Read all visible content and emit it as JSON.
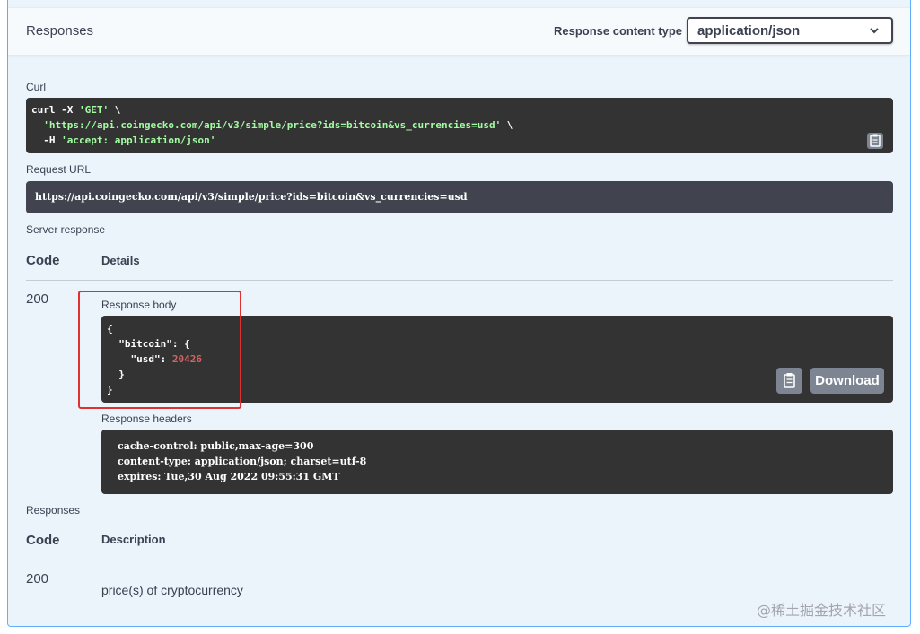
{
  "header": {
    "title": "Responses",
    "content_type_label": "Response content type",
    "content_type_value": "application/json"
  },
  "curl": {
    "label": "Curl",
    "lines": [
      {
        "prefix": "curl -X ",
        "str": "'GET'",
        "suffix": " \\"
      },
      {
        "prefix": "  ",
        "str": "'https://api.coingecko.com/api/v3/simple/price?ids=bitcoin&vs_currencies=usd'",
        "suffix": " \\"
      },
      {
        "prefix": "  -H ",
        "str": "'accept: application/json'",
        "suffix": ""
      }
    ]
  },
  "request_url": {
    "label": "Request URL",
    "value": "https://api.coingecko.com/api/v3/simple/price?ids=bitcoin&vs_currencies=usd"
  },
  "server_response": {
    "label": "Server response",
    "col_code": "Code",
    "col_details": "Details",
    "code": "200",
    "body_label": "Response body",
    "body_lines": [
      {
        "text": "{"
      },
      {
        "text": "  \"bitcoin\": {"
      },
      {
        "key": "    \"usd\": ",
        "num": "20426"
      },
      {
        "text": "  }"
      },
      {
        "text": "}"
      }
    ],
    "download_label": "Download",
    "headers_label": "Response headers",
    "headers_lines": [
      "cache-control: public,max-age=300",
      "content-type: application/json; charset=utf-8",
      "expires: Tue,30 Aug 2022 09:55:31 GMT"
    ]
  },
  "responses": {
    "label": "Responses",
    "col_code": "Code",
    "col_description": "Description",
    "code": "200",
    "description": "price(s) of cryptocurrency"
  },
  "watermark": "@稀土掘金技术社区",
  "colors": {
    "accent_blue": "#61affe",
    "code_bg": "#333333",
    "string_green": "#a2fca2",
    "number_red": "#d36363",
    "highlight_red": "#e03131"
  }
}
